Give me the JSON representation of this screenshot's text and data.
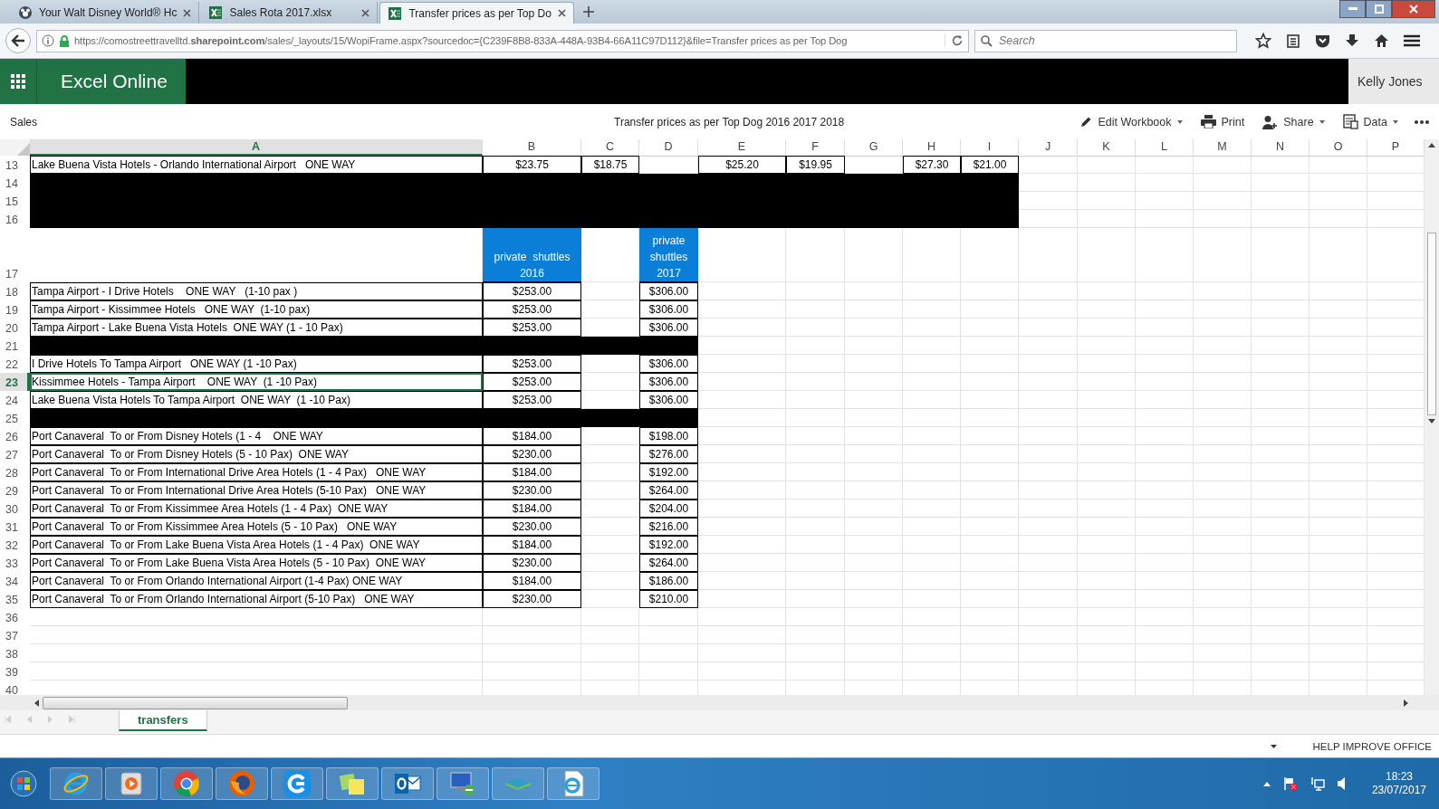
{
  "browser_tabs": [
    {
      "title": "Your Walt Disney World® Hc",
      "selected": false
    },
    {
      "title": "Sales Rota 2017.xlsx",
      "selected": false
    },
    {
      "title": "Transfer prices as per Top Do",
      "selected": true
    }
  ],
  "address": {
    "url": "https://comostreettravelltd.**sharepoint.com**/sales/_layouts/15/WopiFrame.aspx?sourcedoc={C239F8B8-833A-448A-93B4-66A11C97D112}&file=Transfer prices as per Top Dog"
  },
  "search": {
    "placeholder": "Search"
  },
  "app": {
    "title": "Excel Online",
    "user": "Kelly Jones"
  },
  "command_bar": {
    "breadcrumb": "Sales",
    "document_title": "Transfer prices as per Top Dog 2016 2017 2018",
    "commands": [
      {
        "label": "Edit Workbook",
        "dropdown": true
      },
      {
        "label": "Print",
        "dropdown": false
      },
      {
        "label": "Share",
        "dropdown": true
      },
      {
        "label": "Data",
        "dropdown": true
      }
    ]
  },
  "columns": [
    {
      "label": "A",
      "selected": true
    },
    {
      "label": "B",
      "selected": false
    },
    {
      "label": "C",
      "selected": false
    },
    {
      "label": "D",
      "selected": false
    },
    {
      "label": "E",
      "selected": false
    },
    {
      "label": "F",
      "selected": false
    },
    {
      "label": "G",
      "selected": false
    },
    {
      "label": "H",
      "selected": false
    },
    {
      "label": "I",
      "selected": false
    },
    {
      "label": "J",
      "selected": false
    },
    {
      "label": "K",
      "selected": false
    },
    {
      "label": "L",
      "selected": false
    },
    {
      "label": "M",
      "selected": false
    },
    {
      "label": "N",
      "selected": false
    },
    {
      "label": "O",
      "selected": false
    },
    {
      "label": "P",
      "selected": false
    }
  ],
  "rows": [
    {
      "row": "13",
      "kind": "data",
      "selected": false,
      "cells": [
        "Lake Buena Vista Hotels - Orlando International Airport   ONE WAY",
        "$23.75",
        "$18.75",
        null,
        "$25.20",
        "$19.95",
        null,
        "$27.30",
        "$21.00"
      ]
    },
    {
      "row": "14",
      "kind": "wide_band",
      "selected": false
    },
    {
      "row": "15",
      "kind": "wide_band",
      "selected": false
    },
    {
      "row": "16",
      "kind": "wide_band",
      "selected": false
    },
    {
      "row": "17",
      "kind": "header",
      "selected": false,
      "cells": [
        null,
        "private  shuttles 2016",
        null,
        "private shuttles 2017"
      ]
    },
    {
      "row": "18",
      "kind": "data",
      "selected": false,
      "cells": [
        "Tampa Airport - I Drive Hotels    ONE WAY   (1-10 pax )",
        "$253.00",
        null,
        "$306.00"
      ]
    },
    {
      "row": "19",
      "kind": "data",
      "selected": false,
      "cells": [
        "Tampa Airport - Kissimmee Hotels   ONE WAY  (1-10 pax)",
        "$253.00",
        null,
        "$306.00"
      ]
    },
    {
      "row": "20",
      "kind": "data",
      "selected": false,
      "cells": [
        "Tampa Airport - Lake Buena Vista Hotels  ONE WAY (1 - 10 Pax)",
        "$253.00",
        null,
        "$306.00"
      ]
    },
    {
      "row": "21",
      "kind": "narrow_band",
      "selected": false
    },
    {
      "row": "22",
      "kind": "data",
      "selected": false,
      "cells": [
        "I Drive Hotels To Tampa Airport   ONE WAY (1 -10 Pax)",
        "$253.00",
        null,
        "$306.00"
      ]
    },
    {
      "row": "23",
      "kind": "data",
      "selected": true,
      "cells": [
        "Kissimmee Hotels - Tampa Airport    ONE WAY  (1 -10 Pax)",
        "$253.00",
        null,
        "$306.00"
      ]
    },
    {
      "row": "24",
      "kind": "data",
      "selected": false,
      "cells": [
        "Lake Buena Vista Hotels To Tampa Airport  ONE WAY  (1 -10 Pax)",
        "$253.00",
        null,
        "$306.00"
      ]
    },
    {
      "row": "25",
      "kind": "narrow_band",
      "selected": false
    },
    {
      "row": "26",
      "kind": "data",
      "selected": false,
      "cells": [
        "Port Canaveral  To or From Disney Hotels (1 - 4    ONE WAY",
        "$184.00",
        null,
        "$198.00"
      ]
    },
    {
      "row": "27",
      "kind": "data",
      "selected": false,
      "cells": [
        "Port Canaveral  To or From Disney Hotels (5 - 10 Pax)  ONE WAY",
        "$230.00",
        null,
        "$276.00"
      ]
    },
    {
      "row": "28",
      "kind": "data",
      "selected": false,
      "cells": [
        "Port Canaveral  To or From International Drive Area Hotels (1 - 4 Pax)   ONE WAY",
        "$184.00",
        null,
        "$192.00"
      ]
    },
    {
      "row": "29",
      "kind": "data",
      "selected": false,
      "cells": [
        "Port Canaveral  To or From International Drive Area Hotels (5-10 Pax)   ONE WAY",
        "$230.00",
        null,
        "$264.00"
      ]
    },
    {
      "row": "30",
      "kind": "data",
      "selected": false,
      "cells": [
        "Port Canaveral  To or From Kissimmee Area Hotels (1 - 4 Pax)  ONE WAY",
        "$184.00",
        null,
        "$204.00"
      ]
    },
    {
      "row": "31",
      "kind": "data",
      "selected": false,
      "cells": [
        "Port Canaveral  To or From Kissimmee Area Hotels (5 - 10 Pax)   ONE WAY",
        "$230.00",
        null,
        "$216.00"
      ]
    },
    {
      "row": "32",
      "kind": "data",
      "selected": false,
      "cells": [
        "Port Canaveral  To or From Lake Buena Vista Area Hotels (1 - 4 Pax)  ONE WAY",
        "$184.00",
        null,
        "$192.00"
      ]
    },
    {
      "row": "33",
      "kind": "data",
      "selected": false,
      "cells": [
        "Port Canaveral  To or From Lake Buena Vista Area Hotels (5 - 10 Pax)  ONE WAY",
        "$230.00",
        null,
        "$264.00"
      ]
    },
    {
      "row": "34",
      "kind": "data",
      "selected": false,
      "cells": [
        "Port Canaveral  To or From Orlando International Airport (1-4 Pax) ONE WAY",
        "$184.00",
        null,
        "$186.00"
      ]
    },
    {
      "row": "35",
      "kind": "data",
      "selected": false,
      "cells": [
        "Port Canaveral  To or From Orlando International Airport (5-10 Pax)   ONE WAY",
        "$230.00",
        null,
        "$210.00"
      ]
    },
    {
      "row": "36",
      "kind": "blank",
      "selected": false
    },
    {
      "row": "37",
      "kind": "blank",
      "selected": false
    },
    {
      "row": "38",
      "kind": "blank",
      "selected": false
    },
    {
      "row": "39",
      "kind": "blank",
      "selected": false
    },
    {
      "row": "40",
      "kind": "blank",
      "selected": false
    }
  ],
  "sheet_tabs": [
    {
      "label": "transfers",
      "selected": true
    }
  ],
  "status_bar": {
    "text": "HELP IMPROVE OFFICE"
  },
  "taskbar": {
    "time": "18:23",
    "date": "23/07/2017"
  }
}
